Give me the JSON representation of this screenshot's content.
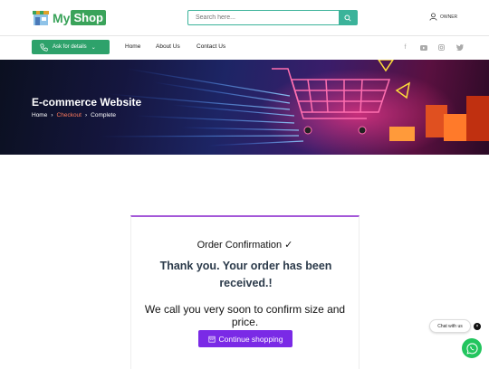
{
  "brand": {
    "my": "My",
    "shop": "Shop",
    "accent": "#3aa35a"
  },
  "search": {
    "placeholder": "Search here..."
  },
  "account": {
    "label": "OWNER"
  },
  "nav": {
    "ask_label": "Ask for details",
    "links": [
      "Home",
      "About Us",
      "Contact Us"
    ],
    "socials": [
      "facebook-icon",
      "youtube-icon",
      "instagram-icon",
      "twitter-icon"
    ]
  },
  "hero": {
    "title": "E-commerce Website",
    "breadcrumb": [
      "Home",
      "Checkout",
      "Complete"
    ]
  },
  "confirmation": {
    "heading": "Order Confirmation ✓",
    "thanks": "Thank you. Your order has been received.!",
    "message": "We call you very soon to confirm size and price.",
    "button": "Continue shopping",
    "accent": "#7a2ae6"
  },
  "chat": {
    "label": "Chat with us",
    "close": "×"
  }
}
